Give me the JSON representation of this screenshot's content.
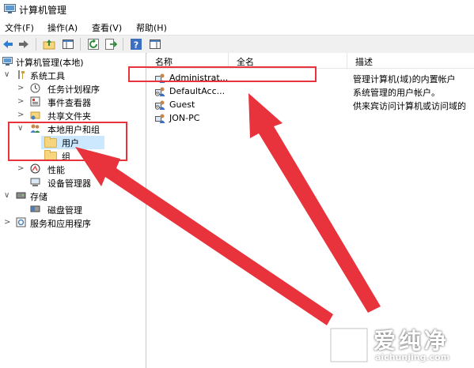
{
  "window": {
    "title": "计算机管理"
  },
  "menu": [
    {
      "label": "文件(F)"
    },
    {
      "label": "操作(A)"
    },
    {
      "label": "查看(V)"
    },
    {
      "label": "帮助(H)"
    }
  ],
  "toolbar": {
    "buttons": [
      "back-icon",
      "forward-icon",
      "up-folder-icon",
      "show-hide-tree-icon",
      "refresh-icon",
      "export-list-icon",
      "help-icon",
      "properties-pane-icon"
    ]
  },
  "tree": {
    "root": "计算机管理(本地)",
    "system_tools": "系统工具",
    "task_scheduler": "任务计划程序",
    "event_viewer": "事件查看器",
    "shared_folders": "共享文件夹",
    "local_users_groups": "本地用户和组",
    "users": "用户",
    "groups": "组",
    "performance": "性能",
    "device_manager": "设备管理器",
    "storage": "存储",
    "disk_management": "磁盘管理",
    "services_apps": "服务和应用程序"
  },
  "list": {
    "columns": {
      "name": "名称",
      "fullname": "全名",
      "description": "描述"
    },
    "rows": [
      {
        "name": "Administrat...",
        "fullname": "",
        "description": "管理计算机(域)的内置帐户"
      },
      {
        "name": "DefaultAcc...",
        "fullname": "",
        "description": "系统管理的用户帐户。"
      },
      {
        "name": "Guest",
        "fullname": "",
        "description": "供来宾访问计算机或访问域的"
      },
      {
        "name": "JON-PC",
        "fullname": "",
        "description": ""
      }
    ]
  },
  "watermark": {
    "text": "爱纯净",
    "url": "aichunjing.com"
  },
  "colors": {
    "annotation": "#e8323c",
    "selection": "#cce8ff"
  }
}
